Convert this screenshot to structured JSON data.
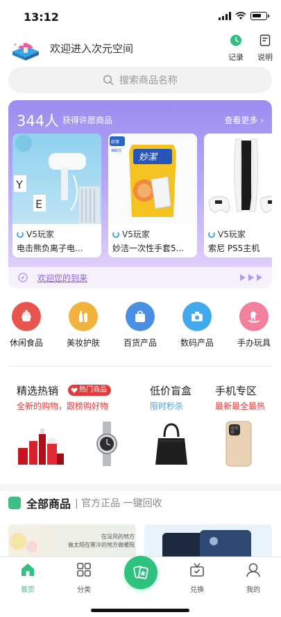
{
  "status_bar": {
    "time": "13:12"
  },
  "header": {
    "title": "欢迎进入次元空间",
    "record_label": "记录",
    "guide_label": "说明"
  },
  "search": {
    "placeholder": "搜索商品名称"
  },
  "license": {
    "count": "344人",
    "subtitle": "获得许愿商品",
    "more": "查看更多 ›",
    "items": [
      {
        "brand": "V5玩家",
        "name": "电击熊负离子电..."
      },
      {
        "brand": "V5玩家",
        "name": "妙洁一次性手套5..."
      },
      {
        "brand": "V5玩家",
        "name": "索尼 PS5主机"
      }
    ],
    "product_text": {
      "box_brand": "妙潔",
      "box_sub": "抽取式",
      "bag_brand": "妙潔"
    },
    "welcome": "欢迎您的到来"
  },
  "categories": [
    {
      "label": "休闲食品",
      "color": "#e8554f"
    },
    {
      "label": "美妆护肤",
      "color": "#f2b23e"
    },
    {
      "label": "百货产品",
      "color": "#4a8fe2"
    },
    {
      "label": "数码产品",
      "color": "#41a9ec"
    },
    {
      "label": "手办玩具",
      "color": "#f27f9b"
    }
  ],
  "promos": {
    "hot": {
      "title": "精选热销",
      "badge": "热门商品",
      "sub": "全新的购物，跟榜购好物"
    },
    "blind": {
      "title": "低价盲盒",
      "sub": "限时秒杀"
    },
    "phone": {
      "title": "手机专区",
      "sub": "最新最全最热"
    }
  },
  "all_goods": {
    "title": "全部商品",
    "subtitle": "| 官方正品 一键回收",
    "banner_line1": "在没风的地方",
    "banner_line2": "做太阳在寒冷的地方做暖阳"
  },
  "tabbar": {
    "home": "首页",
    "category": "分类",
    "exchange": "兑换",
    "mine": "我的"
  },
  "colors": {
    "accent": "#2ec27e",
    "hot_red": "#e23b3b",
    "sale_blue": "#4aa3e8"
  }
}
